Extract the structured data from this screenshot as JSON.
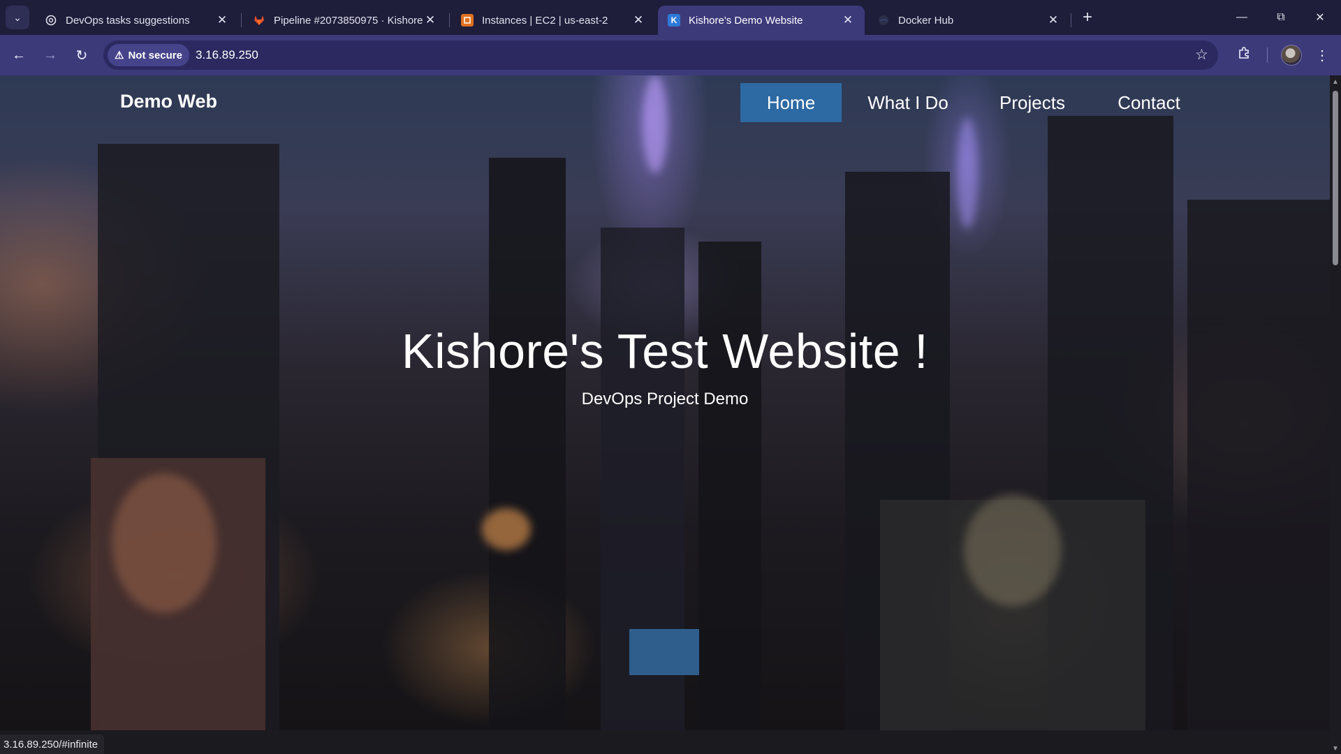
{
  "browser": {
    "tabs": [
      {
        "title": "DevOps tasks suggestions",
        "favicon": "openai-icon",
        "active": false
      },
      {
        "title": "Pipeline #2073850975 · Kishore",
        "favicon": "gitlab-icon",
        "active": false
      },
      {
        "title": "Instances | EC2 | us-east-2",
        "favicon": "aws-ec2-icon",
        "active": false
      },
      {
        "title": "Kishore's Demo Website",
        "favicon": "k-icon",
        "active": true
      },
      {
        "title": "Docker Hub",
        "favicon": "docker-icon",
        "active": false
      }
    ],
    "security_label": "Not secure",
    "url": "3.16.89.250",
    "status_url": "3.16.89.250/#infinite",
    "accent_color": "#3d3a7a"
  },
  "site": {
    "brand": "Demo Web",
    "nav": [
      {
        "label": "Home",
        "active": true
      },
      {
        "label": "What I Do",
        "active": false
      },
      {
        "label": "Projects",
        "active": false
      },
      {
        "label": "Contact",
        "active": false
      }
    ],
    "hero_title": "Kishore's Test Website !",
    "hero_subtitle": "DevOps Project Demo",
    "active_nav_color": "#2d6aa3"
  }
}
